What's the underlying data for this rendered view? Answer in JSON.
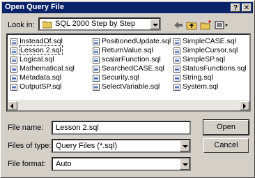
{
  "window": {
    "title": "Open Query File",
    "help_label": "?",
    "close_label": "✕"
  },
  "lookin": {
    "label": "Look in:",
    "value": "SQL 2000 Step by Step"
  },
  "toolbar": {
    "icons": [
      "back-icon",
      "up-folder-icon",
      "new-folder-icon",
      "view-menu-icon"
    ]
  },
  "files": {
    "col1": [
      "InsteadOf.sql",
      "Lesson 2.sql",
      "Logical.sql",
      "Mathematical.sql",
      "Metadata.sql",
      "OutputSP.sql"
    ],
    "col2": [
      "PositionedUpdate.sql",
      "ReturnValue.sql",
      "scalarFunction.sql",
      "SearchedCASE.sql",
      "Security.sql",
      "SelectVariable.sql"
    ],
    "col3": [
      "SimpleCASE.sql",
      "SimpleCursor.sql",
      "SimpleSP.sql",
      "StatusFunctions.sql",
      "String.sql",
      "System.sql"
    ],
    "selected": "Lesson 2.sql"
  },
  "form": {
    "filename_label": "File name:",
    "filename_value": "Lesson 2.sql",
    "filetype_label": "Files of type:",
    "filetype_value": "Query Files (*.sql)",
    "fileformat_label": "File format:",
    "fileformat_value": "Auto"
  },
  "buttons": {
    "open": "Open",
    "cancel": "Cancel"
  },
  "colors": {
    "titlebar": "#0a246a",
    "face": "#d4d0c8",
    "folder": "#e8c75a"
  }
}
